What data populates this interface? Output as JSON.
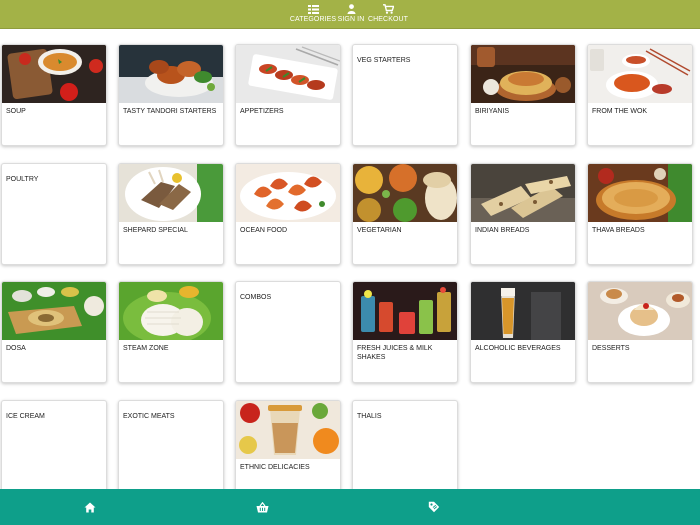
{
  "nav": {
    "categories": {
      "label": "CATEGORIES",
      "icon": "grid-list-icon"
    },
    "signin": {
      "label": "SIGN IN",
      "icon": "user-icon"
    },
    "checkout": {
      "label": "CHECKOUT",
      "icon": "cart-icon"
    }
  },
  "categories": [
    {
      "name": "SOUP",
      "image": "soup"
    },
    {
      "name": "TASTY TANDORI STARTERS",
      "image": "tandoori"
    },
    {
      "name": "APPETIZERS",
      "image": "appetizers"
    },
    {
      "name": "VEG STARTERS",
      "image": ""
    },
    {
      "name": "BIRIYANIS",
      "image": "biriyani"
    },
    {
      "name": "FROM THE WOK",
      "image": "wok"
    },
    {
      "name": "POULTRY",
      "image": ""
    },
    {
      "name": "SHEPARD SPECIAL",
      "image": "shepard"
    },
    {
      "name": "OCEAN FOOD",
      "image": "ocean"
    },
    {
      "name": "VEGETARIAN",
      "image": "vegetarian"
    },
    {
      "name": "INDIAN BREADS",
      "image": "breads"
    },
    {
      "name": "THAVA BREADS",
      "image": "thava"
    },
    {
      "name": "DOSA",
      "image": "dosa"
    },
    {
      "name": "STEAM ZONE",
      "image": "steam"
    },
    {
      "name": "COMBOS",
      "image": ""
    },
    {
      "name": "FRESH JUICES & MILK SHAKES",
      "image": "juices"
    },
    {
      "name": "ALCOHOLIC BEVERAGES",
      "image": "beer"
    },
    {
      "name": "DESSERTS",
      "image": "desserts"
    },
    {
      "name": "ICE CREAM",
      "image": ""
    },
    {
      "name": "EXOTIC MEATS",
      "image": ""
    },
    {
      "name": "ETHNIC DELICACIES",
      "image": "ethnic"
    },
    {
      "name": "THALIS",
      "image": ""
    }
  ],
  "bottom_nav": [
    {
      "icon": "home-icon"
    },
    {
      "icon": "basket-icon"
    },
    {
      "icon": "tag-icon"
    }
  ],
  "colors": {
    "topbar": "#a3b247",
    "bottombar": "#0e9f8a"
  }
}
